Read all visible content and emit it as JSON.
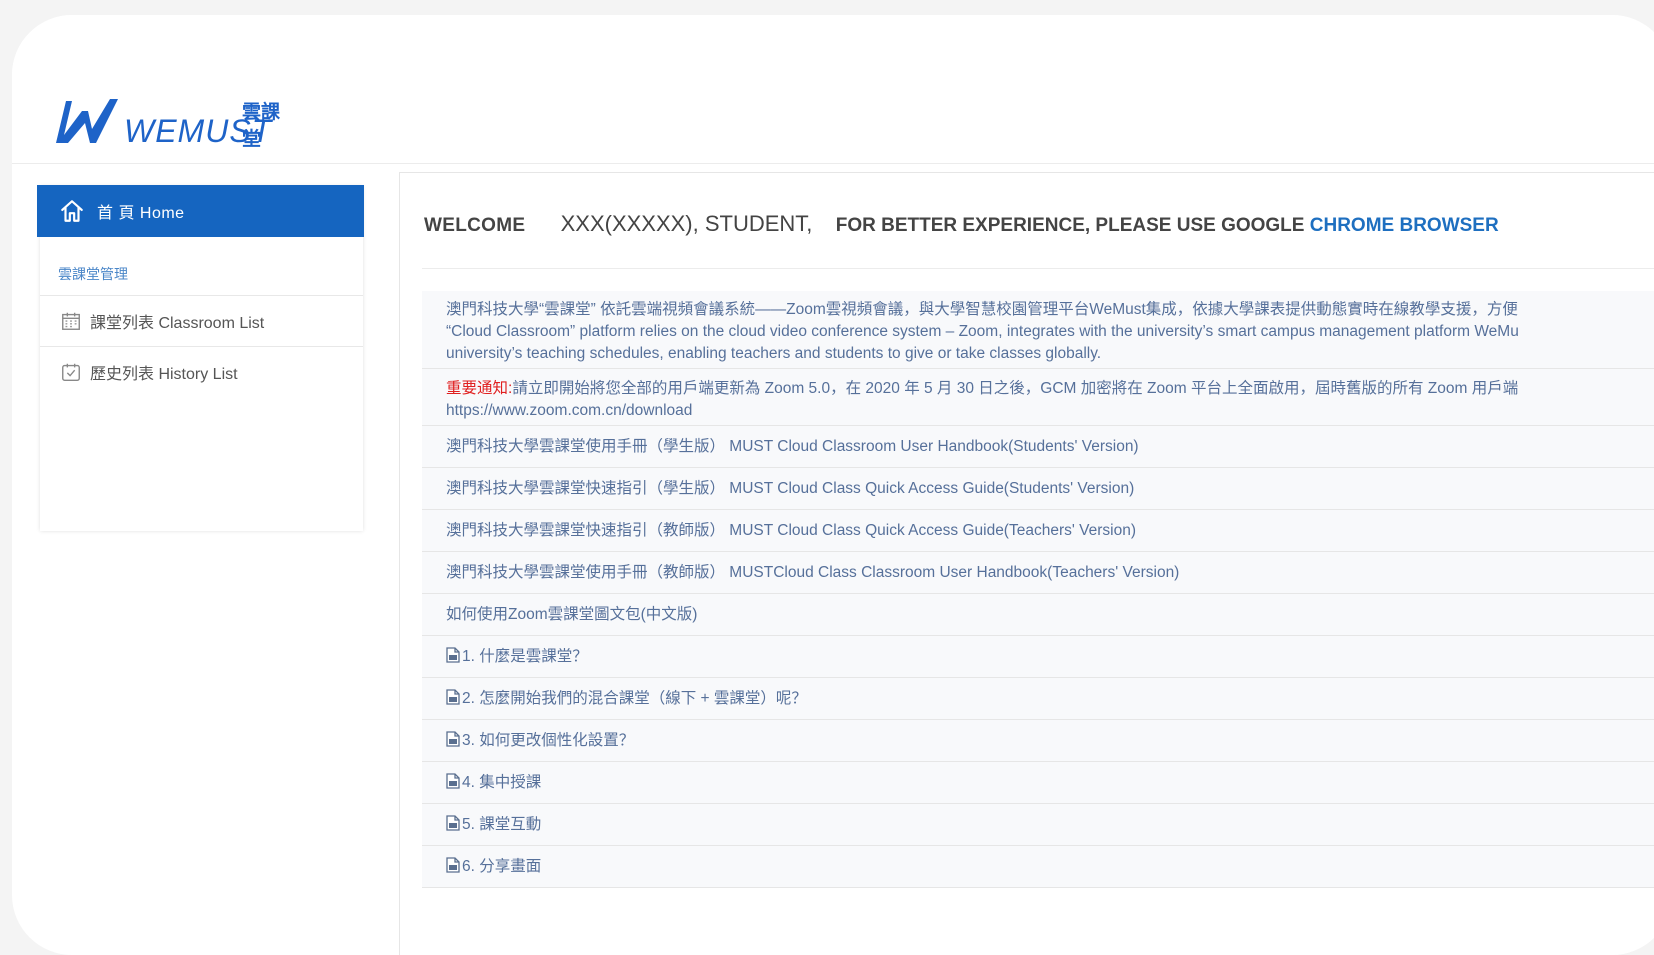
{
  "brand": {
    "logo_cn": "雲課堂",
    "logo_en": "WEMUST",
    "color": "#1e63c8"
  },
  "sidebar": {
    "home_label": "首 頁 Home",
    "section_title": "雲課堂管理",
    "items": [
      {
        "label": "課堂列表 Classroom List",
        "icon": "calendar-icon"
      },
      {
        "label": "歷史列表 History List",
        "icon": "calendar-check-icon"
      }
    ]
  },
  "welcome": {
    "welcome": "WELCOME",
    "user": "XXX(XXXXX), STUDENT,",
    "tip": "FOR BETTER EXPERIENCE, PLEASE USE GOOGLE ",
    "browser": "CHROME BROWSER"
  },
  "content": {
    "intro_cn": "澳門科技大學“雲課堂” 依託雲端視頻會議系統——Zoom雲視頻會議，與大學智慧校園管理平台WeMust集成，依據大學課表提供動態實時在線教學支援，方便",
    "intro_en1": "“Cloud Classroom” platform relies on the cloud video conference system – Zoom, integrates with the university’s smart campus management platform WeMu",
    "intro_en2": "university’s teaching schedules, enabling teachers and students to give or take classes globally.",
    "notice_label": "重要通知:",
    "notice_text": "請立即開始將您全部的用戶端更新為 Zoom 5.0，在 2020 年 5 月 30 日之後，GCM 加密將在 Zoom 平台上全面啟用，屆時舊版的所有 Zoom 用戶端",
    "notice_link": "https://www.zoom.com.cn/download",
    "links": [
      "澳門科技大學雲課堂使用手冊（學生版） MUST Cloud Classroom User Handbook(Students' Version)",
      "澳門科技大學雲課堂快速指引（學生版） MUST Cloud Class Quick Access Guide(Students' Version)",
      "澳門科技大學雲課堂快速指引（教師版） MUST Cloud Class Quick Access Guide(Teachers' Version)",
      "澳門科技大學雲課堂使用手冊（教師版） MUSTCloud Class Classroom User Handbook(Teachers' Version)",
      "如何使用Zoom雲課堂圖文包(中文版)"
    ],
    "docs": [
      "1. 什麼是雲課堂？",
      "2. 怎麼開始我們的混合課堂（線下 + 雲課堂）呢？",
      "3. 如何更改個性化設置？",
      "4. 集中授課",
      "5. 課堂互動",
      "6. 分享畫面"
    ]
  }
}
